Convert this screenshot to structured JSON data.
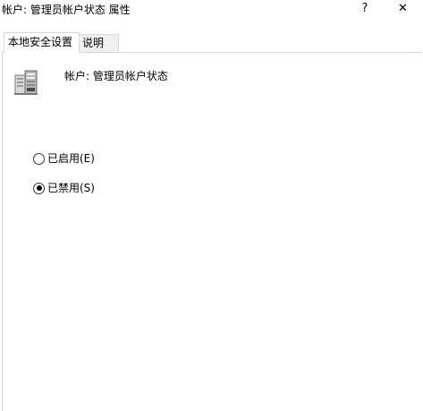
{
  "window": {
    "title": "帐户: 管理员帐户状态 属性",
    "help_label": "?",
    "close_label": "✕"
  },
  "tabs": [
    {
      "label": "本地安全设置",
      "active": true
    },
    {
      "label": "说明",
      "active": false
    }
  ],
  "policy": {
    "icon": "server-policy-icon",
    "name": "帐户: 管理员帐户状态"
  },
  "options": [
    {
      "label": "已启用(E)",
      "checked": false
    },
    {
      "label": "已禁用(S)",
      "checked": true
    }
  ]
}
